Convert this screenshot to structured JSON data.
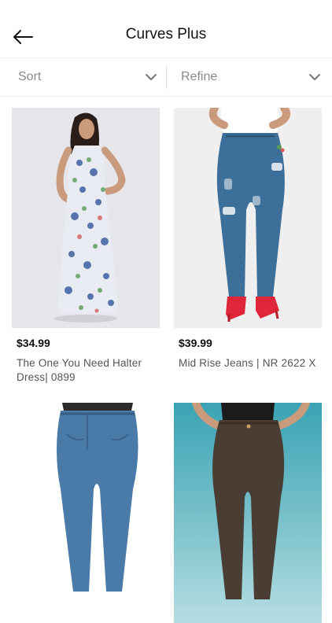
{
  "header": {
    "title": "Curves Plus",
    "back_icon": "arrow-left-icon"
  },
  "filters": {
    "sort_label": "Sort",
    "refine_label": "Refine",
    "chevron_icon": "chevron-down-icon"
  },
  "products": [
    {
      "price": "$34.99",
      "name": "The One You Need Halter Dress| 0899"
    },
    {
      "price": "$39.99",
      "name": "Mid Rise Jeans | NR 2622 X"
    },
    {
      "price": "",
      "name": ""
    },
    {
      "price": "",
      "name": ""
    }
  ]
}
